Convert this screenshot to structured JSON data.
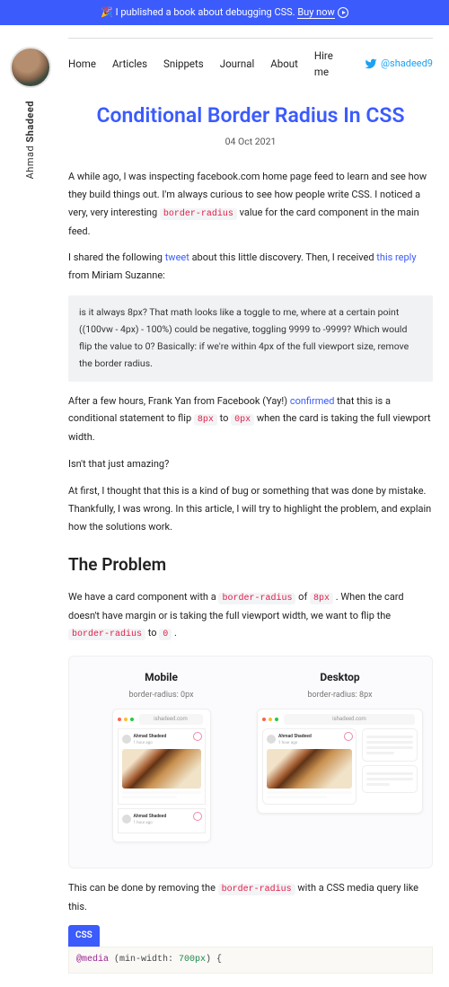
{
  "announce": {
    "emoji": "🎉",
    "text": "I published a book about debugging CSS.",
    "cta": "Buy now"
  },
  "author": {
    "first": "Ahmad",
    "last": "Shadeed",
    "handle": "@shadeed9"
  },
  "nav": {
    "home": "Home",
    "articles": "Articles",
    "snippets": "Snippets",
    "journal": "Journal",
    "about": "About",
    "hire": "Hire me"
  },
  "post": {
    "title": "Conditional Border Radius In CSS",
    "date": "04 Oct 2021",
    "p1_a": "A while ago, I was inspecting facebook.com home page feed to learn and see how they build things out. I'm always curious to see how people write CSS. I noticed a very, very interesting ",
    "p1_code": "border-radius",
    "p1_b": " value for the card component in the main feed.",
    "p2_a": "I shared the following ",
    "p2_link1": "tweet",
    "p2_b": " about this little discovery. Then, I received ",
    "p2_link2": "this reply",
    "p2_c": " from Miriam Suzanne:",
    "quote": "is it always 8px? That math looks like a toggle to me, where at a certain point ((100vw - 4px) - 100%) could be negative, toggling 9999 to -9999? Which would flip the value to 0? Basically: if we're within 4px of the full viewport size, remove the border radius.",
    "p3_a": "After a few hours, Frank Yan from Facebook (Yay!) ",
    "p3_link": "confirmed",
    "p3_b": " that this is a conditional statement to flip ",
    "p3_code1": "8px",
    "p3_c": " to ",
    "p3_code2": "0px",
    "p3_d": " when the card is taking the full viewport width.",
    "p4": "Isn't that just amazing?",
    "p5": "At first, I thought that this is a kind of bug or something that was done by mistake. Thankfully, I was wrong. In this article, I will try to highlight the problem, and explain how the solutions work.",
    "h2": "The Problem",
    "p6_a": "We have a card component with a ",
    "p6_code1": "border-radius",
    "p6_b": " of ",
    "p6_code2": "8px",
    "p6_c": " . When the card doesn't have margin or is taking the full viewport width, we want to flip the ",
    "p6_code3": "border-radius",
    "p6_d": " to ",
    "p6_code4": "0",
    "p6_e": " .",
    "fig": {
      "mobile_title": "Mobile",
      "mobile_sub": "border-radius: 0px",
      "desktop_title": "Desktop",
      "desktop_sub": "border-radius: 8px",
      "url": "ishadeed.com",
      "card_name": "Ahmad Shadeed",
      "card_time": "1 hour ago"
    },
    "p7_a": "This can be done by removing the ",
    "p7_code": "border-radius",
    "p7_b": " with a CSS media query like this.",
    "codelabel": "CSS",
    "codeline_kw": "@media",
    "codeline_mid": " (min-width: ",
    "codeline_num": "700px",
    "codeline_end": ") {"
  }
}
